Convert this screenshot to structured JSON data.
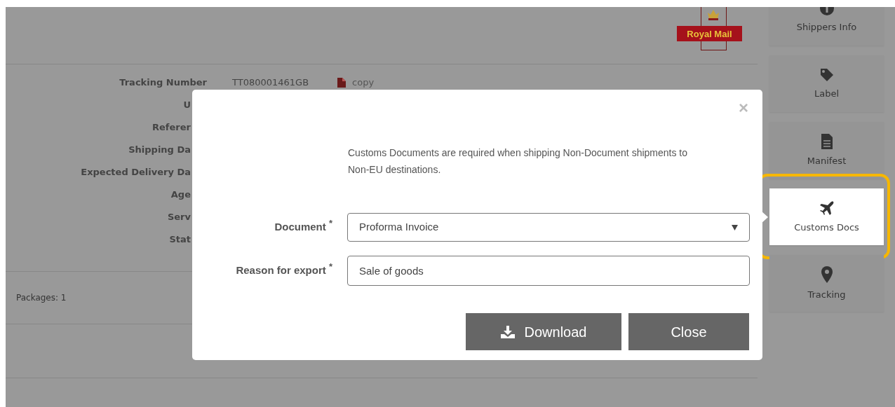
{
  "header": {
    "logo_text": "Royal Mail"
  },
  "details": [
    {
      "label": "Tracking Number",
      "value": "TT080001461GB",
      "action": "copy"
    },
    {
      "label": "U"
    },
    {
      "label": "Referer"
    },
    {
      "label": "Shipping Da"
    },
    {
      "label": "Expected Delivery Da"
    },
    {
      "label": "Age"
    },
    {
      "label": "Serv"
    },
    {
      "label": "Stat"
    }
  ],
  "packages": "Packages: 1",
  "sidebar": {
    "items": [
      {
        "label": "Shippers Info",
        "kind": "info",
        "selected": false,
        "highlighted": false
      },
      {
        "label": "Label",
        "kind": "tag",
        "selected": false,
        "highlighted": false
      },
      {
        "label": "Manifest",
        "kind": "document",
        "selected": false,
        "highlighted": false
      },
      {
        "label": "Customs Docs",
        "kind": "plane",
        "selected": true,
        "highlighted": true
      },
      {
        "label": "Tracking",
        "kind": "pin",
        "selected": false,
        "highlighted": false
      }
    ]
  },
  "modal": {
    "close_symbol": "×",
    "intro": "Customs Documents are required when shipping Non-Document shipments to Non-EU destinations.",
    "fields": [
      {
        "kind": "select",
        "label": "Document",
        "required_mark": "*",
        "value": "Proforma Invoice"
      },
      {
        "kind": "text",
        "label": "Reason for export",
        "required_mark": "*",
        "value": "Sale of goods"
      }
    ],
    "buttons": [
      {
        "kind": "download",
        "label": "Download"
      },
      {
        "kind": "close",
        "label": "Close"
      }
    ]
  }
}
